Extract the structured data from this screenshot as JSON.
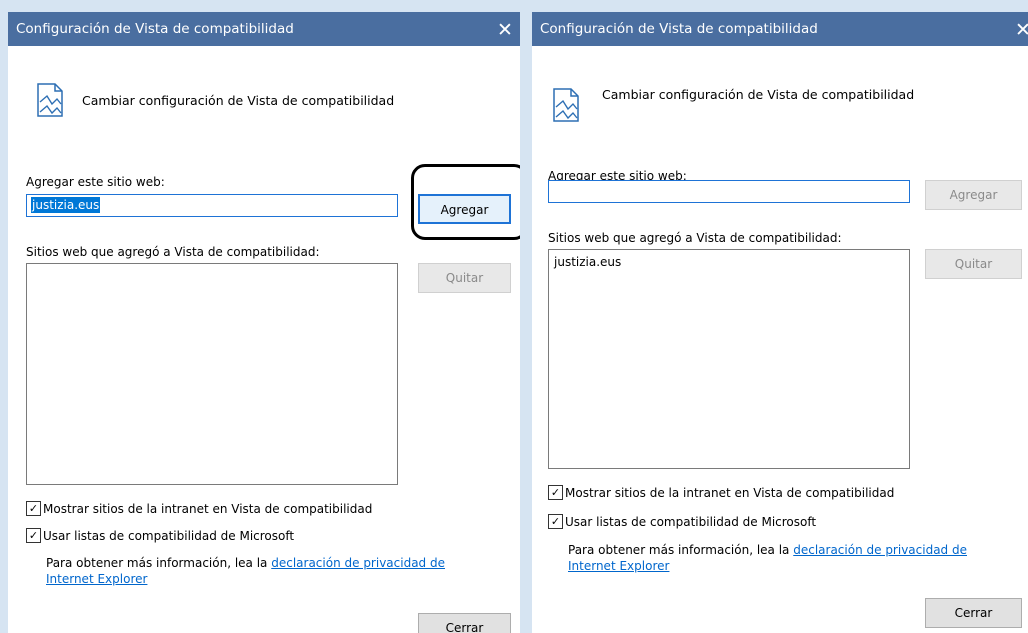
{
  "dialogs": [
    {
      "title": "Configuración de Vista de compatibilidad",
      "close_glyph": "✕",
      "heading": "Cambiar configuración de Vista de compatibilidad",
      "add_label": "Agregar este sitio web:",
      "add_input_value": "justizia.eus",
      "add_button_label": "Agregar",
      "add_button_state": "focused",
      "list_label": "Sitios web que agregó a Vista de compatibilidad:",
      "list_items": [],
      "remove_button_label": "Quitar",
      "checkbox_intranet_label": "Mostrar sitios de la intranet en Vista de compatibilidad",
      "checkbox_intranet_checked": true,
      "checkbox_microsoft_label": "Usar listas de compatibilidad de Microsoft",
      "checkbox_microsoft_checked": true,
      "info_text": "Para obtener más información, lea la",
      "info_link": "declaración de privacidad de Internet Explorer",
      "close_button_label": "Cerrar"
    },
    {
      "title": "Configuración de Vista de compatibilidad",
      "close_glyph": "✕",
      "heading": "Cambiar configuración de Vista de compatibilidad",
      "add_label": "Agregar este sitio web:",
      "add_input_value": "",
      "add_button_label": "Agregar",
      "add_button_state": "disabled",
      "list_label": "Sitios web que agregó a Vista de compatibilidad:",
      "list_items": [
        "justizia.eus"
      ],
      "remove_button_label": "Quitar",
      "checkbox_intranet_label": "Mostrar sitios de la intranet en Vista de compatibilidad",
      "checkbox_intranet_checked": true,
      "checkbox_microsoft_label": "Usar listas de compatibilidad de Microsoft",
      "checkbox_microsoft_checked": true,
      "info_text": "Para obtener más información, lea la",
      "info_link": "declaración de privacidad de Internet Explorer",
      "close_button_label": "Cerrar"
    }
  ],
  "colors": {
    "titlebar": "#4a6ea0",
    "backdrop": "#d6e4f2",
    "selection": "#0078d7",
    "link": "#0066cc"
  },
  "icons": {
    "title_close": "close-icon",
    "page": "page-icon"
  }
}
